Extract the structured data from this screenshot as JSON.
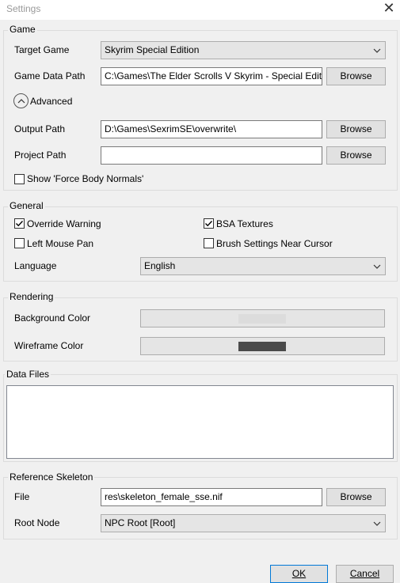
{
  "window": {
    "title": "Settings"
  },
  "game": {
    "legend": "Game",
    "target_game_label": "Target Game",
    "target_game_value": "Skyrim Special Edition",
    "game_data_path_label": "Game Data Path",
    "game_data_path_value": "C:\\Games\\The Elder Scrolls V Skyrim - Special Edition\\Data\\",
    "browse_label": "Browse",
    "advanced_label": "Advanced",
    "output_path_label": "Output Path",
    "output_path_value": "D:\\Games\\SexrimSE\\overwrite\\",
    "project_path_label": "Project Path",
    "project_path_value": "",
    "force_body_normals_label": "Show 'Force Body Normals'",
    "force_body_normals_checked": false
  },
  "general": {
    "legend": "General",
    "override_warning_label": "Override Warning",
    "override_warning_checked": true,
    "bsa_textures_label": "BSA Textures",
    "bsa_textures_checked": true,
    "left_mouse_pan_label": "Left Mouse Pan",
    "left_mouse_pan_checked": false,
    "brush_settings_label": "Brush Settings Near Cursor",
    "brush_settings_checked": false,
    "language_label": "Language",
    "language_value": "English"
  },
  "rendering": {
    "legend": "Rendering",
    "background_color_label": "Background Color",
    "background_color": "#dcdcdc",
    "wireframe_color_label": "Wireframe Color",
    "wireframe_color": "#4a4a4a"
  },
  "data_files": {
    "legend": "Data Files",
    "items": []
  },
  "reference_skeleton": {
    "legend": "Reference Skeleton",
    "file_label": "File",
    "file_value": "res\\skeleton_female_sse.nif",
    "browse_label": "Browse",
    "root_node_label": "Root Node",
    "root_node_value": "NPC Root [Root]"
  },
  "footer": {
    "ok_label": "OK",
    "cancel_label": "Cancel"
  }
}
